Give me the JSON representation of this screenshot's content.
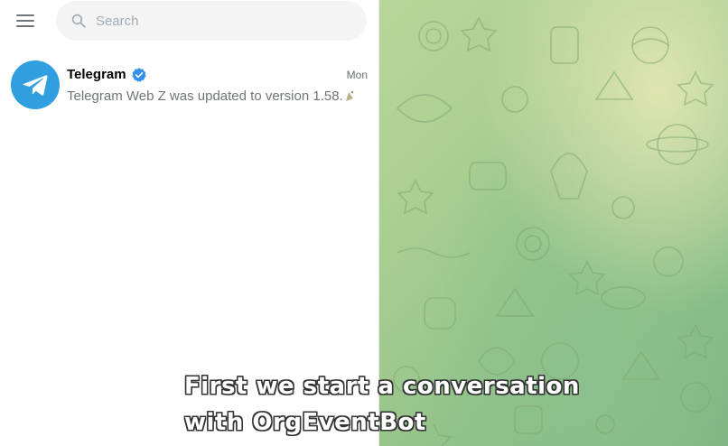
{
  "sidebar": {
    "search": {
      "placeholder": "Search"
    },
    "chats": [
      {
        "title": "Telegram",
        "verified": true,
        "time": "Mon",
        "preview": "Telegram Web Z was updated to version 1.58.",
        "preview_emoji": "party-icon"
      }
    ]
  },
  "caption": {
    "line1": "First we start a conversation",
    "line2": "with OrgEventBot"
  },
  "colors": {
    "accent": "#2f9fe0",
    "background_green": "#a4cc8e",
    "verified": "#3390ec"
  }
}
